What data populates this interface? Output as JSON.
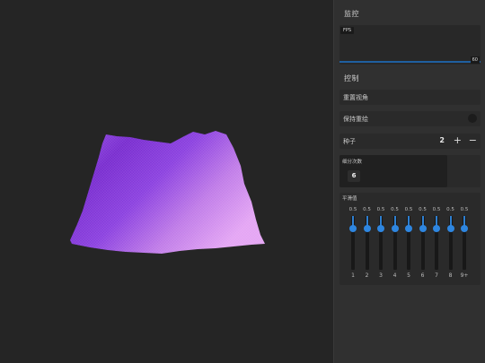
{
  "panel": {
    "monitor_title": "监控",
    "fps_label": "FPS",
    "fps_max": "60",
    "control_title": "控制",
    "reset_view": "重置视角",
    "keep_redraw": "保持重绘",
    "seed_label": "种子",
    "seed_value": "2",
    "plus": "+",
    "minus": "−",
    "subdiv_label": "细分次数",
    "subdiv_value": "6",
    "smooth_label": "平滑值",
    "smooth_values": [
      "0.5",
      "0.5",
      "0.5",
      "0.5",
      "0.5",
      "0.5",
      "0.5",
      "0.5",
      "0.5"
    ],
    "smooth_indices": [
      "1",
      "2",
      "3",
      "4",
      "5",
      "6",
      "7",
      "8",
      "9+"
    ]
  },
  "colors": {
    "accent": "#2e86e0",
    "terrain_dark": "#7a2ed0",
    "terrain_light": "#d28af0"
  }
}
